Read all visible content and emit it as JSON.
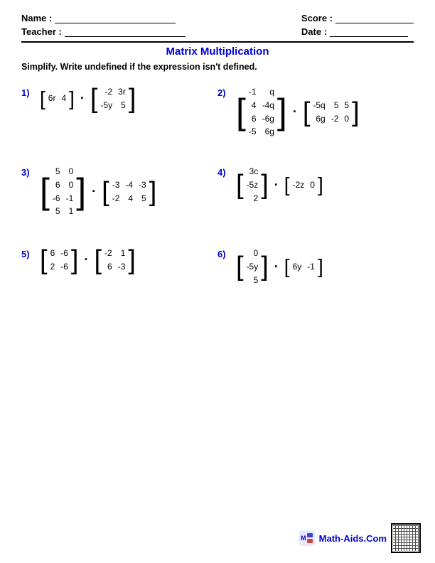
{
  "header": {
    "name_label": "Name :",
    "teacher_label": "Teacher :",
    "score_label": "Score :",
    "date_label": "Date :"
  },
  "title": "Matrix Multiplication",
  "instructions": "Simplify. Write undefined if the expression isn't defined.",
  "problems": [
    {
      "number": "1)",
      "matrix_a": {
        "rows": 1,
        "cols": 2,
        "cells": [
          [
            "6r",
            "4"
          ]
        ]
      },
      "matrix_b": {
        "rows": 2,
        "cols": 2,
        "cells": [
          [
            "-2",
            "3r"
          ],
          [
            "-5y",
            "5"
          ]
        ]
      }
    },
    {
      "number": "2)",
      "matrix_a": {
        "rows": 4,
        "cols": 2,
        "cells": [
          [
            "-1",
            "q"
          ],
          [
            "4",
            "-4q"
          ],
          [
            "6",
            "-6g"
          ],
          [
            "-5",
            "6g"
          ]
        ]
      },
      "matrix_b": {
        "rows": 2,
        "cols": 3,
        "cells": [
          [
            "-5q",
            "5",
            "5"
          ],
          [
            "6g",
            "-2",
            "0"
          ]
        ]
      }
    },
    {
      "number": "3)",
      "matrix_a": {
        "rows": 4,
        "cols": 2,
        "cells": [
          [
            "5",
            "0"
          ],
          [
            "6",
            "0"
          ],
          [
            "-6",
            "-1"
          ],
          [
            "5",
            "1"
          ]
        ]
      },
      "matrix_b": {
        "rows": 2,
        "cols": 3,
        "cells": [
          [
            "-3",
            "-4",
            "-3"
          ],
          [
            "-2",
            "4",
            "5"
          ]
        ]
      }
    },
    {
      "number": "4)",
      "matrix_a": {
        "rows": 3,
        "cols": 1,
        "cells": [
          [
            "3c"
          ],
          [
            "-5z"
          ],
          [
            "2"
          ]
        ]
      },
      "matrix_b": {
        "rows": 1,
        "cols": 2,
        "cells": [
          [
            "-2z",
            "0"
          ]
        ]
      }
    },
    {
      "number": "5)",
      "matrix_a": {
        "rows": 2,
        "cols": 2,
        "cells": [
          [
            "6",
            "-6"
          ],
          [
            "2",
            "-6"
          ]
        ]
      },
      "matrix_b": {
        "rows": 2,
        "cols": 2,
        "cells": [
          [
            "-2",
            "1"
          ],
          [
            "6",
            "-3"
          ]
        ]
      }
    },
    {
      "number": "6)",
      "matrix_a": {
        "rows": 3,
        "cols": 1,
        "cells": [
          [
            "0"
          ],
          [
            "-5y"
          ],
          [
            "5"
          ]
        ]
      },
      "matrix_b": {
        "rows": 1,
        "cols": 2,
        "cells": [
          [
            "6y",
            "-1"
          ]
        ]
      }
    }
  ],
  "footer": {
    "site_text": "Math-Aids.Com"
  }
}
